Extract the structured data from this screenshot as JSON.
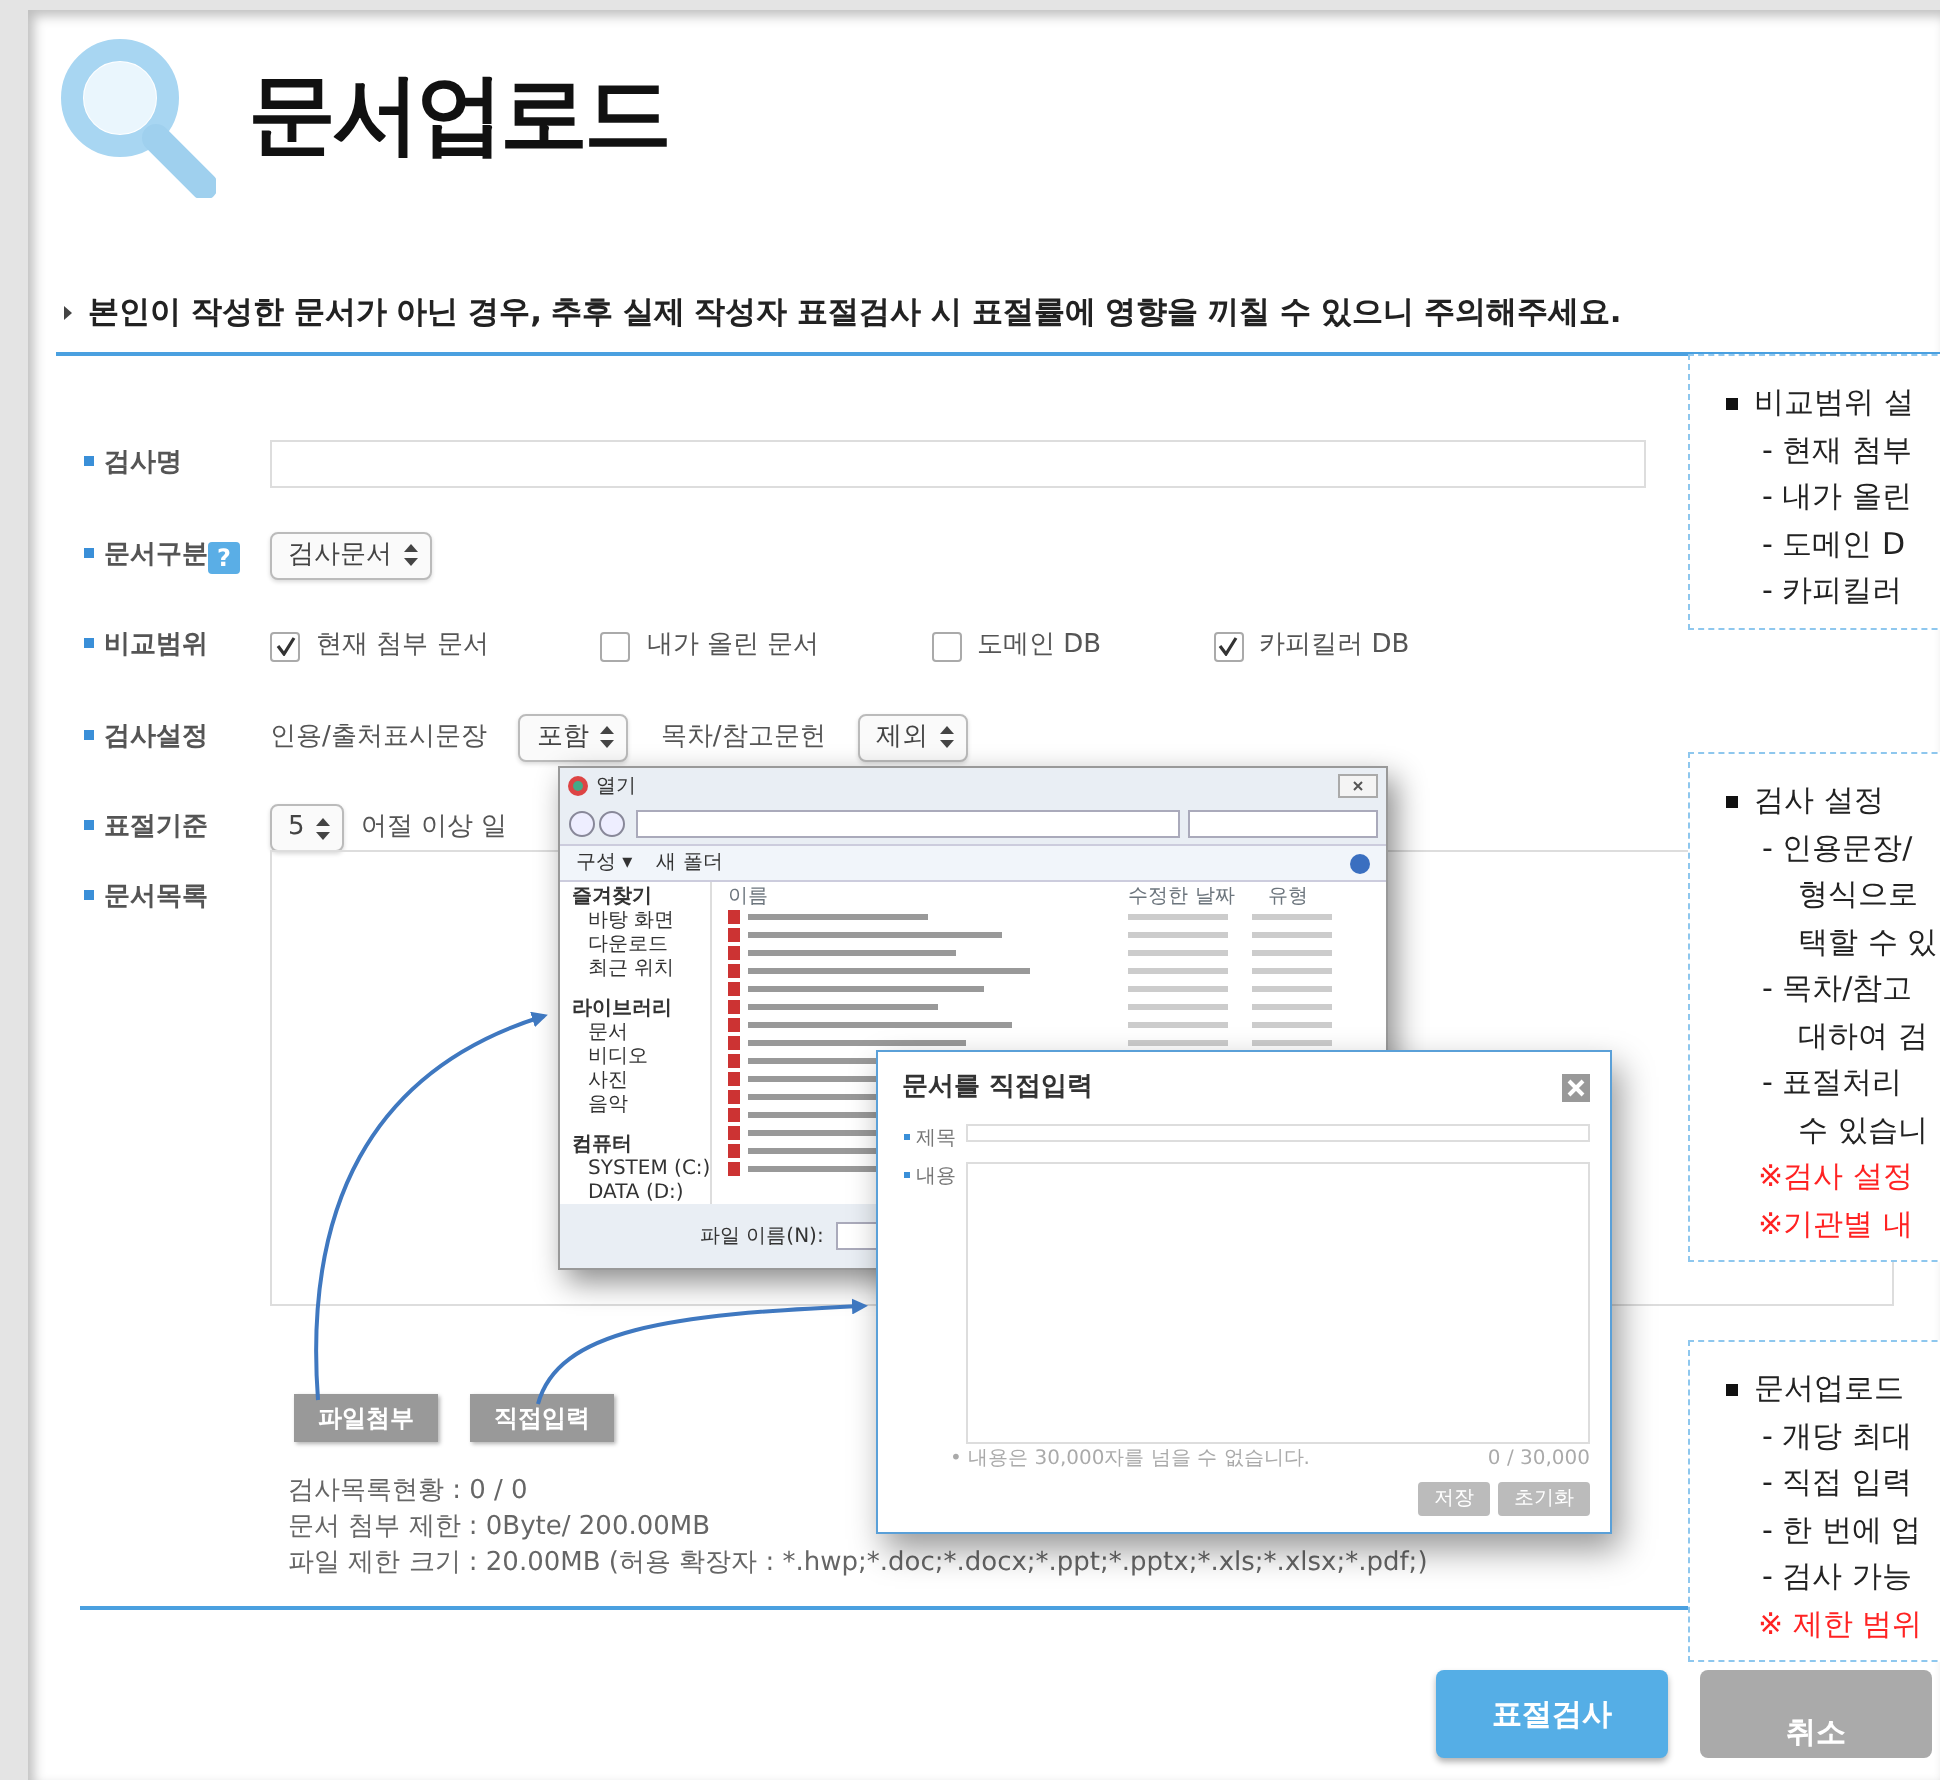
{
  "title": "문서업로드",
  "notice": "본인이 작성한 문서가 아닌 경우, 추후 실제 작성자 표절검사 시 표절률에 영향을 끼칠 수 있으니 주의해주세요.",
  "exam_name": {
    "label": "검사명"
  },
  "doc_type": {
    "label": "문서구분",
    "help": "?",
    "select": "검사문서"
  },
  "scope": {
    "label": "비교범위",
    "options": [
      {
        "label": "현재 첨부 문서",
        "checked": true
      },
      {
        "label": "내가 올린 문서",
        "checked": false
      },
      {
        "label": "도메인 DB",
        "checked": false
      },
      {
        "label": "카피킬러 DB",
        "checked": true
      }
    ]
  },
  "settings": {
    "label": "검사설정",
    "items": [
      {
        "label": "인용/출처표시문장",
        "select": "포함"
      },
      {
        "label": "목차/참고문헌",
        "select": "제외"
      }
    ]
  },
  "threshold": {
    "label": "표절기준",
    "select": "5",
    "suffix": "어절 이상 일"
  },
  "doc_list": {
    "label": "문서목록",
    "buttons": [
      "파일첨부",
      "직접입력"
    ],
    "stats": [
      "검사목록현황 : 0 / 0",
      "문서 첨부 제한 : 0Byte/ 200.00MB",
      "파일 제한 크기 : 20.00MB (허용 확장자 : *.hwp;*.doc;*.docx;*.ppt;*.pptx;*.xls;*.xlsx;*.pdf;)"
    ]
  },
  "actions": [
    {
      "label": "표절검사",
      "kind": "primary"
    },
    {
      "label": "취소",
      "kind": "secondary"
    }
  ],
  "file_dialog": {
    "title": "열기",
    "toolbar": [
      "구성 ▾",
      "새 폴더"
    ],
    "sidebar": [
      {
        "label": "즐겨찾기",
        "kind": "group"
      },
      {
        "label": "바탕 화면",
        "kind": "item"
      },
      {
        "label": "다운로드",
        "kind": "item"
      },
      {
        "label": "최근 위치",
        "kind": "item"
      },
      {
        "label": "라이브러리",
        "kind": "group"
      },
      {
        "label": "문서",
        "kind": "item"
      },
      {
        "label": "비디오",
        "kind": "item"
      },
      {
        "label": "사진",
        "kind": "item"
      },
      {
        "label": "음악",
        "kind": "item"
      },
      {
        "label": "컴퓨터",
        "kind": "group"
      },
      {
        "label": "SYSTEM (C:)",
        "kind": "item"
      },
      {
        "label": "DATA (D:)",
        "kind": "item"
      }
    ],
    "columns": [
      "이름",
      "수정한 날짜",
      "유형"
    ],
    "filename_label": "파일 이름(N):"
  },
  "input_dialog": {
    "title": "문서를 직접입력",
    "fields": [
      "제목",
      "내용"
    ],
    "note": "• 내용은 30,000자를 넘을 수 없습니다.",
    "counter": "0 / 30,000",
    "buttons": [
      "저장",
      "초기화"
    ]
  },
  "help_panels": [
    {
      "lines": [
        {
          "kind": "head",
          "text": "비교범위  설"
        },
        {
          "kind": "dash",
          "text": "- 현재 첨부"
        },
        {
          "kind": "dash",
          "text": "- 내가 올린"
        },
        {
          "kind": "dash",
          "text": "- 도메인 D"
        },
        {
          "kind": "dash",
          "text": "- 카피킬러"
        }
      ]
    },
    {
      "lines": [
        {
          "kind": "head",
          "text": "검사 설정"
        },
        {
          "kind": "dash",
          "text": "- 인용문장/"
        },
        {
          "kind": "cont",
          "text": "형식으로"
        },
        {
          "kind": "cont",
          "text": "택할 수 있"
        },
        {
          "kind": "dash",
          "text": "- 목차/참고"
        },
        {
          "kind": "cont",
          "text": "대하여  검"
        },
        {
          "kind": "dash",
          "text": "- 표절처리"
        },
        {
          "kind": "cont",
          "text": "수 있습니"
        },
        {
          "kind": "note",
          "text": "※검사 설정"
        },
        {
          "kind": "note",
          "text": "※기관별 내"
        }
      ]
    },
    {
      "lines": [
        {
          "kind": "head",
          "text": "문서업로드"
        },
        {
          "kind": "dash",
          "text": "- 개당 최대"
        },
        {
          "kind": "dash",
          "text": "- 직접 입력"
        },
        {
          "kind": "dash",
          "text": "- 한 번에 업"
        },
        {
          "kind": "dash",
          "text": "- 검사 가능"
        },
        {
          "kind": "note",
          "text": "※ 제한 범위"
        }
      ]
    }
  ]
}
